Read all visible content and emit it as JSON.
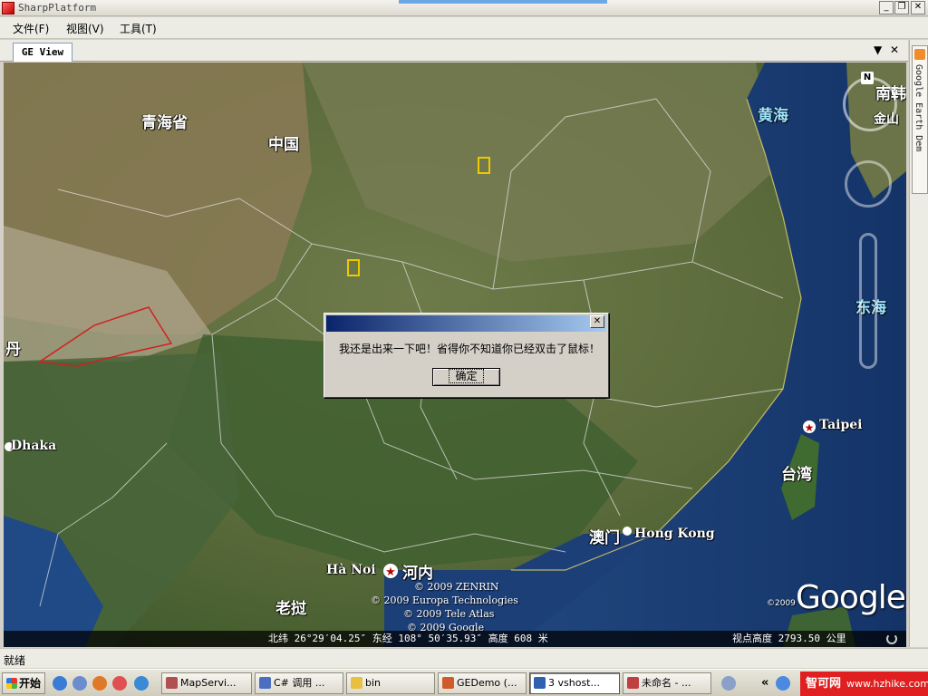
{
  "window": {
    "title": "SharpPlatform"
  },
  "menu": {
    "items": [
      "文件(F)",
      "视图(V)",
      "工具(T)"
    ]
  },
  "document": {
    "tab_label": "GE View",
    "dropdown": "▼",
    "close": "✕"
  },
  "dock": {
    "side_tab_label": "Google Earth Dem"
  },
  "map": {
    "labels": {
      "qinghai": "青海省",
      "zhongguo": "中国",
      "huanghai": "黄海",
      "donghai": "东海",
      "nanhan": "南韩",
      "jin": "金山",
      "dan": "丹",
      "dhaka": "Dhaka",
      "taipei": "Taipei",
      "taiwan": "台湾",
      "aomen": "澳门",
      "hongkong": "Hong Kong",
      "hanoi": "Hà Noi",
      "henei": "河内",
      "laowo": "老挝"
    },
    "copyright_lines": [
      "© 2009 ZENRIN",
      "© 2009 Europa Technologies",
      "© 2009 Tele Atlas",
      "© 2009 Google"
    ],
    "google_logo": "Google",
    "google_copy": "©2009",
    "nav_n": "N",
    "coordinates": "北纬 26°29′04.25″  东经 108° 50′35.93″  高度  608 米",
    "eye_altitude": "视点高度  2793.50 公里"
  },
  "dialog": {
    "message": "我还是出来一下吧！省得你不知道你已经双击了鼠标！",
    "ok_label": "确定",
    "close": "✕"
  },
  "status": {
    "text": "就绪"
  },
  "taskbar": {
    "start": "开始",
    "buttons": [
      "MapServi...",
      "C# 调用 ...",
      "bin",
      "GEDemo (...",
      "3 vshost...",
      "未命名 - ..."
    ],
    "tray_arrows": "«"
  },
  "watermark": {
    "brand": "智可网",
    "url": "www.hzhike.com"
  }
}
